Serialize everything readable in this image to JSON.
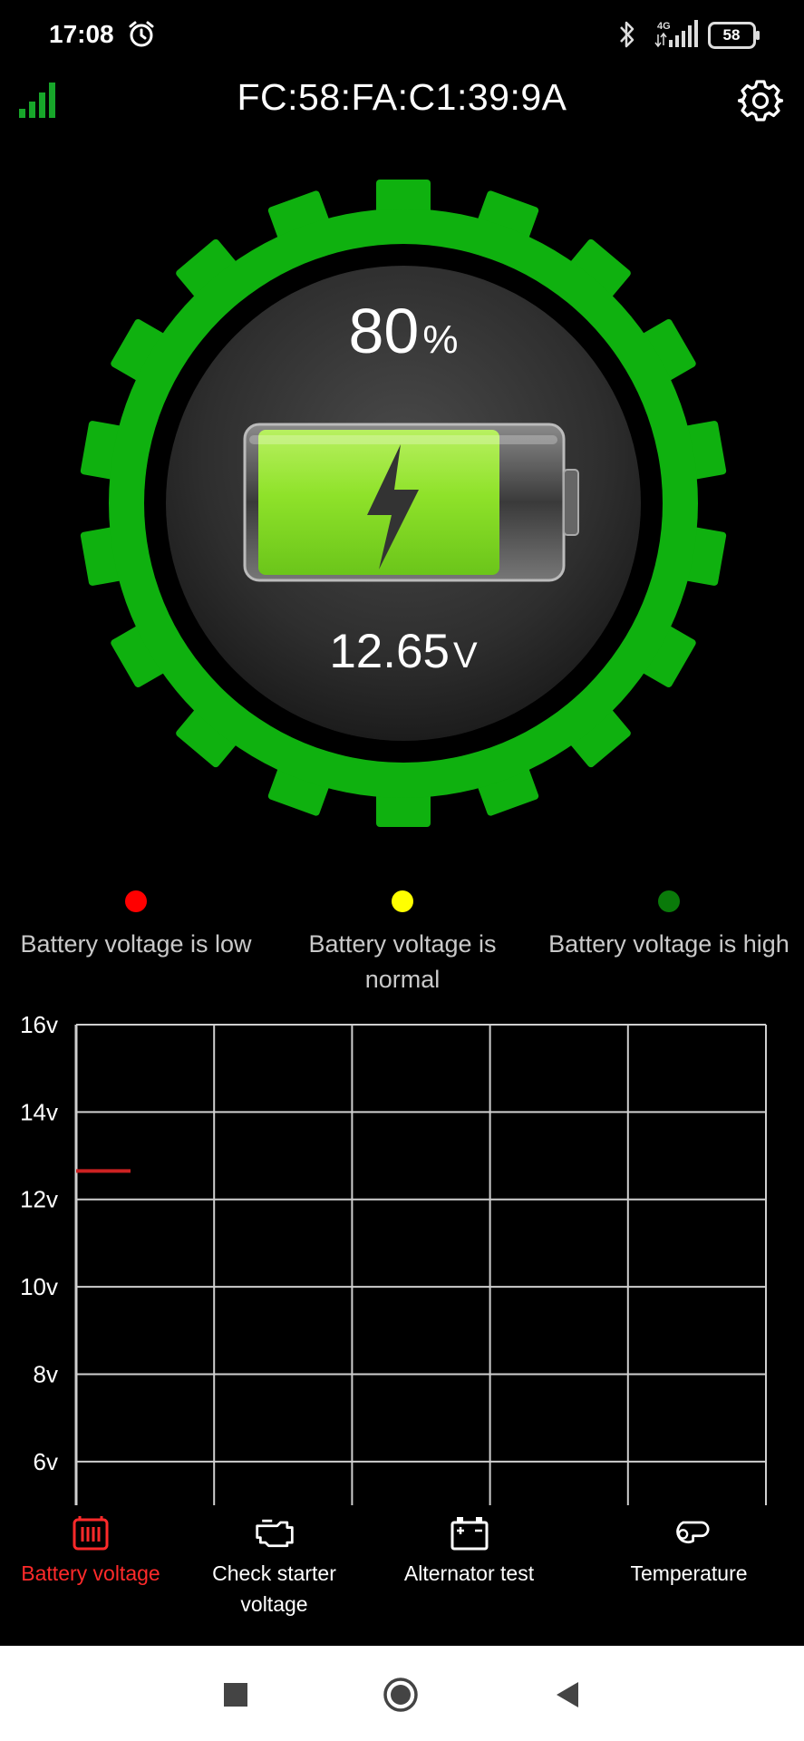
{
  "status_bar": {
    "time": "17:08",
    "battery_level": "58",
    "network_label": "4G",
    "icons": [
      "alarm-icon",
      "bluetooth-icon",
      "cellular-signal-icon",
      "phone-battery-icon"
    ]
  },
  "header": {
    "device_address": "FC:58:FA:C1:39:9A",
    "icons": [
      "signal-strength-icon",
      "gear-icon"
    ]
  },
  "gauge": {
    "charge_value": "80",
    "charge_unit": "%",
    "charge_fraction": 0.8,
    "voltage_value": "12.65",
    "voltage_unit": "V",
    "ring_color": "#0fb10f",
    "battery_fill_color": "#8fe22a",
    "icons": [
      "battery-charging-icon",
      "lightning-bolt-icon"
    ]
  },
  "legend": [
    {
      "label": "Battery voltage is low",
      "color": "#ff0000"
    },
    {
      "label": "Battery voltage is normal",
      "color": "#ffff00"
    },
    {
      "label": "Battery voltage is high",
      "color": "#0a7a0a"
    }
  ],
  "chart_data": {
    "type": "line",
    "y_ticks": [
      "16v",
      "14v",
      "12v",
      "10v",
      "8v",
      "6v"
    ],
    "y_tick_values": [
      16,
      14,
      12,
      10,
      8,
      6
    ],
    "ylim": [
      5,
      16
    ],
    "grid": true,
    "series": [
      {
        "color": "#cc2222",
        "values": [
          12.65,
          12.65
        ]
      }
    ]
  },
  "bottom_nav": [
    {
      "label": "Battery voltage",
      "icon": "battery-voltage-icon",
      "active": true
    },
    {
      "label": "Check starter\nvoltage",
      "icon": "engine-icon",
      "active": false
    },
    {
      "label": "Alternator test",
      "icon": "car-battery-icon",
      "active": false
    },
    {
      "label": "Temperature",
      "icon": "thermometer-icon",
      "active": false
    }
  ],
  "system_nav": {
    "icons": [
      "recents-square-icon",
      "home-circle-icon",
      "back-triangle-icon"
    ]
  }
}
